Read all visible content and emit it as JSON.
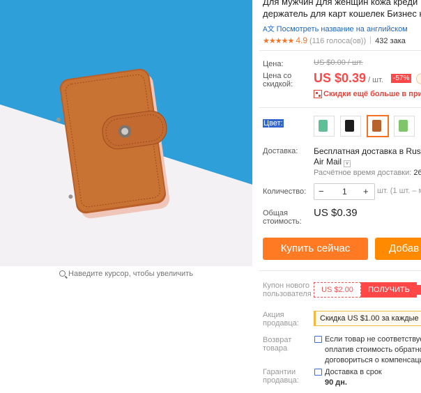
{
  "product": {
    "title_line1": "Для мужчин Для женщин кожа креди",
    "title_line2": "держатель для карт кошелек Бизнес к",
    "translate_link": "Посмотреть название на английском",
    "rating_stars": "★★★★★",
    "rating_score": "4.9",
    "rating_votes": "(116 голоса(ов))",
    "orders": "432 зака"
  },
  "image": {
    "zoom_hint": "Наведите курсор, чтобы увеличить"
  },
  "price": {
    "label_price": "Цена:",
    "original": "US $0.00 / шт.",
    "label_discount_line1": "Цена со",
    "label_discount_line2": "скидкой:",
    "current": "US $0.39",
    "unit": "/ шт.",
    "discount_badge": "-57%",
    "promo_text": "Скидки ещё больше в прило"
  },
  "color": {
    "label": "Цвет:",
    "options": [
      "mint",
      "black",
      "brown",
      "green"
    ],
    "selected": "brown"
  },
  "shipping": {
    "label": "Доставка:",
    "line1": "Бесплатная доставка в Russia",
    "line2": "Air Mail",
    "estimate_label": "Расчётное время доставки:",
    "estimate_value": "26-"
  },
  "quantity": {
    "label": "Количество:",
    "minus": "−",
    "value": "1",
    "plus": "+",
    "note": "шт. (1 шт. – м"
  },
  "total": {
    "label_line1": "Общая",
    "label_line2": "стоимость:",
    "value": "US $0.39"
  },
  "actions": {
    "buy_now": "Купить сейчас",
    "add_to_cart": "Добав"
  },
  "coupon": {
    "label_line1": "Купон нового",
    "label_line2": "пользователя",
    "value": "US $2.00",
    "get": "ПОЛУЧИТЬ"
  },
  "store_promo": {
    "label_line1": "Акция",
    "label_line2": "продавца:",
    "text": "Скидка US $1.00 за каждые US"
  },
  "returns": {
    "label_line1": "Возврат",
    "label_line2": "товара",
    "line1": "Если товар не соответствует",
    "line2": "оплатив стоимость обратно",
    "line3": "договориться о компенсаци"
  },
  "guarantee": {
    "label_line1": "Гарантии",
    "label_line2": "продавца:",
    "line1": "Доставка в срок",
    "line2": "90 дн."
  },
  "colors": {
    "accent": "#ff4747",
    "buy_button": "#ff7a22",
    "star": "#f57224",
    "link": "#1a66c7"
  }
}
